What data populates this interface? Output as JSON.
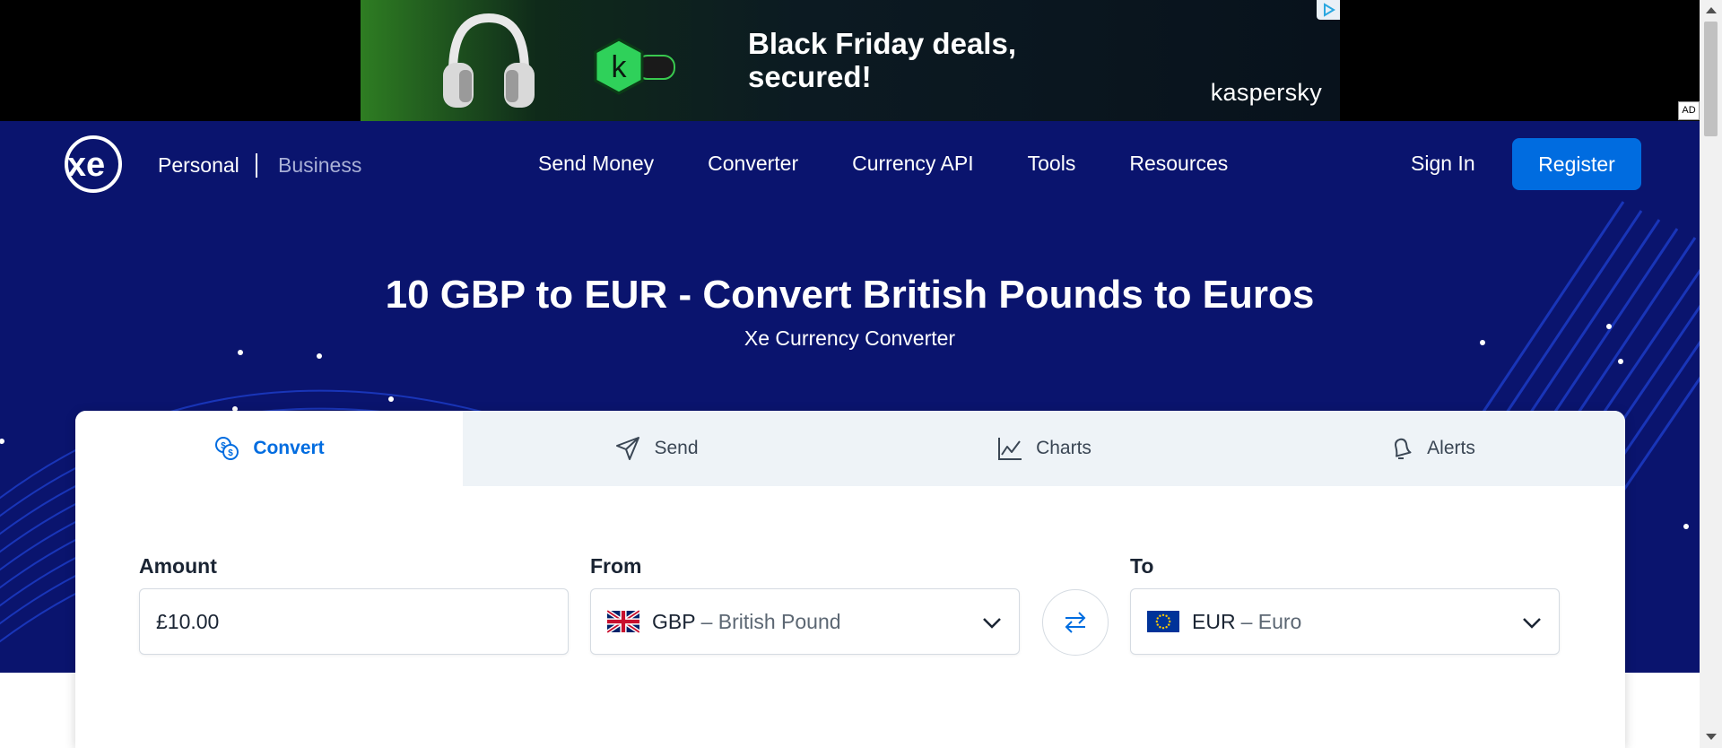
{
  "ad": {
    "headline": "Black Friday deals, secured!",
    "brand": "kaspersky",
    "label": "AD",
    "badge_letter": "k"
  },
  "nav": {
    "logo_text": "xe",
    "personal": "Personal",
    "business": "Business",
    "links": [
      "Send Money",
      "Converter",
      "Currency API",
      "Tools",
      "Resources"
    ],
    "sign_in": "Sign In",
    "register": "Register"
  },
  "hero": {
    "title": "10 GBP to EUR - Convert British Pounds to Euros",
    "subtitle": "Xe Currency Converter"
  },
  "tabs": [
    {
      "label": "Convert",
      "icon": "currency-exchange-icon",
      "active": true
    },
    {
      "label": "Send",
      "icon": "paper-plane-icon",
      "active": false
    },
    {
      "label": "Charts",
      "icon": "line-chart-icon",
      "active": false
    },
    {
      "label": "Alerts",
      "icon": "bell-icon",
      "active": false
    }
  ],
  "converter": {
    "amount_label": "Amount",
    "amount_value": "£10.00",
    "from_label": "From",
    "from_code": "GBP",
    "from_name": "– British Pound",
    "to_label": "To",
    "to_code": "EUR",
    "to_name": "– Euro"
  },
  "colors": {
    "hero_bg": "#0a146e",
    "accent": "#006ce0",
    "tab_inactive_bg": "#eef3f7"
  }
}
